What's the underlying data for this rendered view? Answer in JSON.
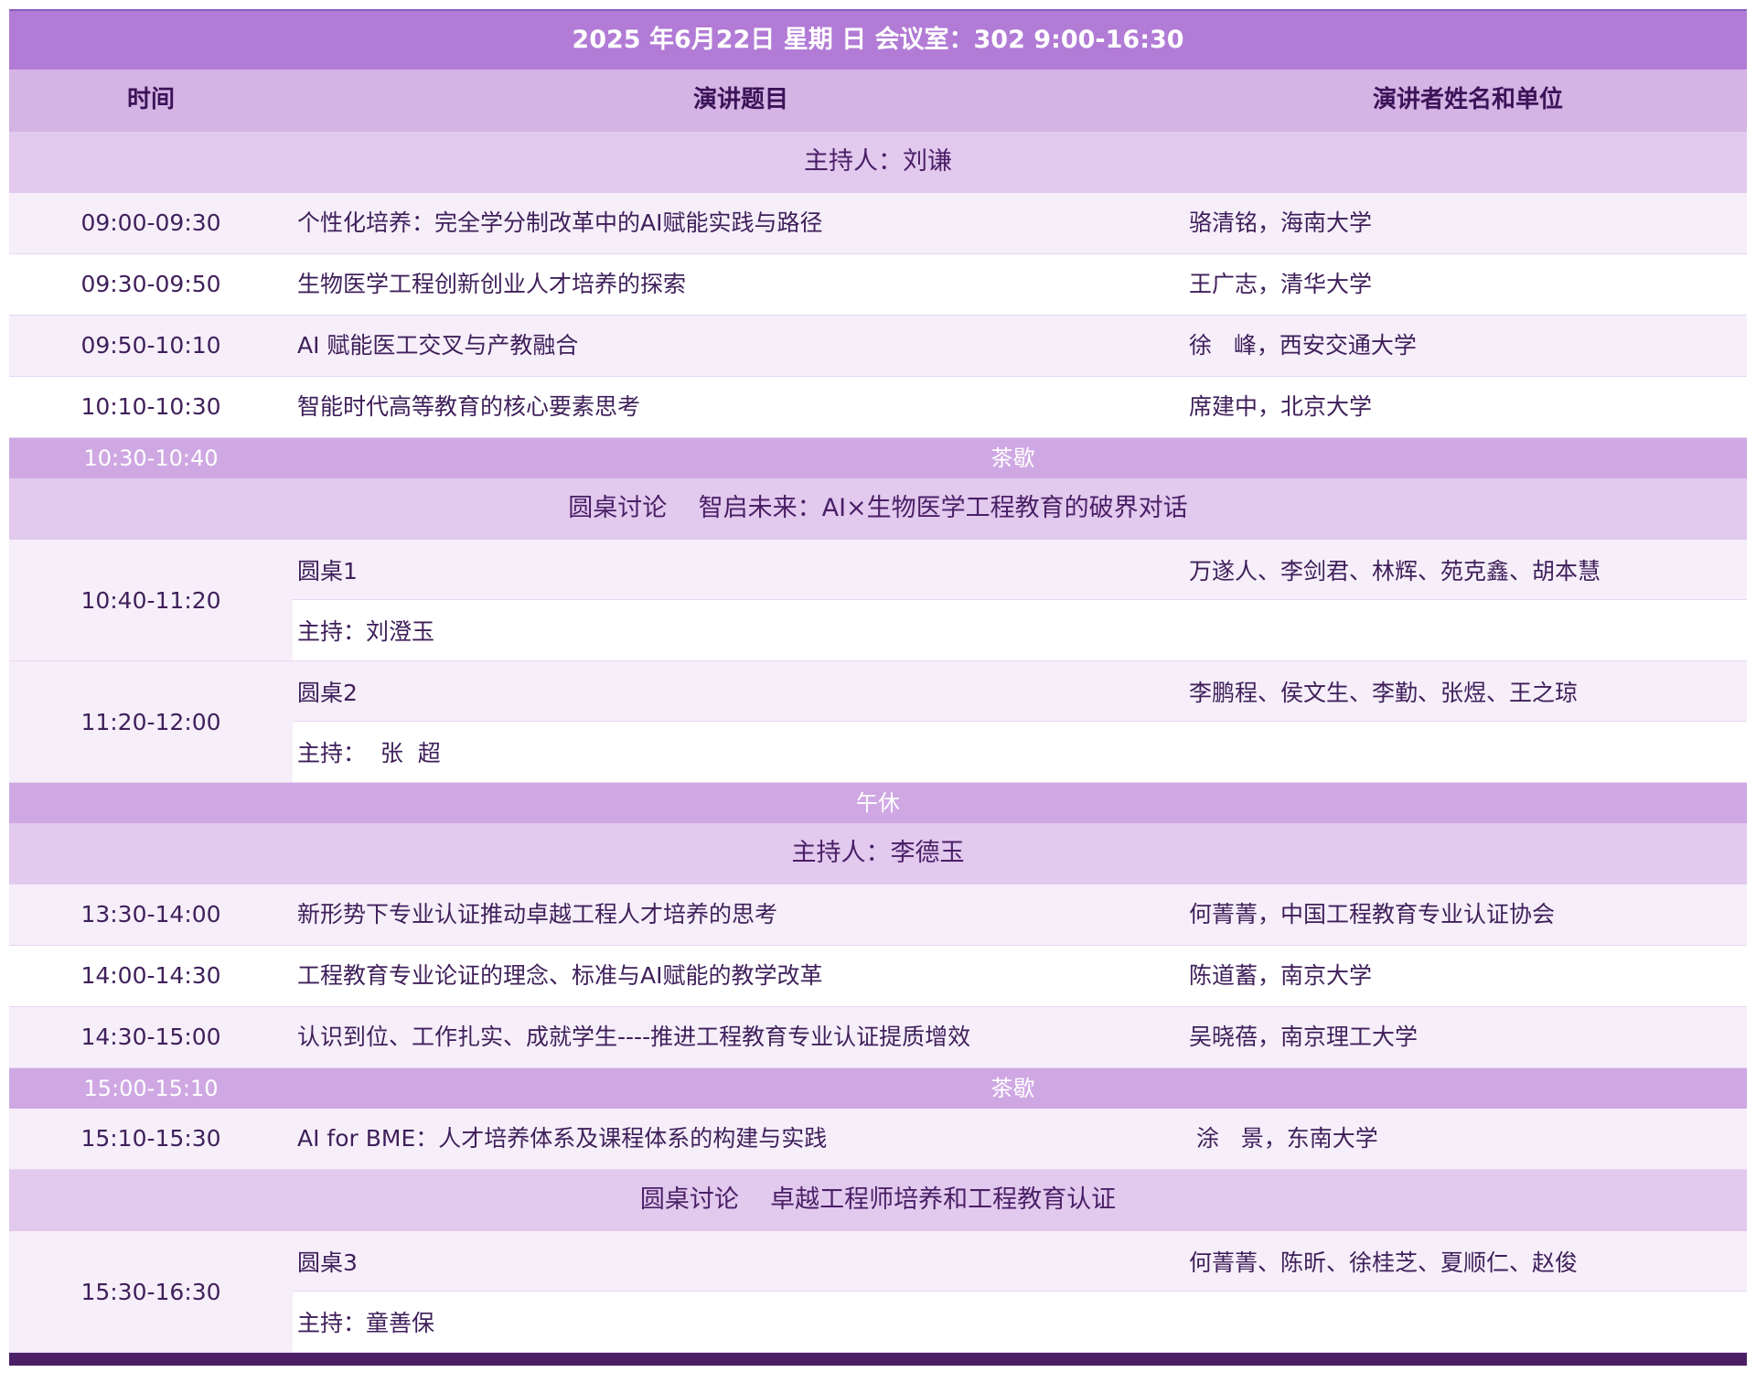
{
  "header": {
    "title": "2025 年6月22日  星期 日  会议室：302    9:00-16:30"
  },
  "columns": {
    "time": "时间",
    "title": "演讲题目",
    "speaker": "演讲者姓名和单位"
  },
  "sections": {
    "host1": "主持人：刘谦",
    "panel1": "圆桌讨论    智启未来：AI×生物医学工程教育的破界对话",
    "lunch": "午休",
    "host2": "主持人：李德玉",
    "panel2": "圆桌讨论    卓越工程师培养和工程教育认证"
  },
  "talks1": [
    {
      "time": "09:00-09:30",
      "title": "个性化培养：完全学分制改革中的AI赋能实践与路径",
      "speaker": "骆清铭，海南大学"
    },
    {
      "time": "09:30-09:50",
      "title": "生物医学工程创新创业人才培养的探索",
      "speaker": "王广志，清华大学"
    },
    {
      "time": "09:50-10:10",
      "title": "AI 赋能医工交叉与产教融合",
      "speaker": "徐   峰，西安交通大学"
    },
    {
      "time": "10:10-10:30",
      "title": "智能时代高等教育的核心要素思考",
      "speaker": "席建中，北京大学"
    }
  ],
  "break1": {
    "time": "10:30-10:40",
    "label": "茶歇"
  },
  "roundtables1": [
    {
      "time": "10:40-11:20",
      "name": "圆桌1",
      "members": "万遂人、李剑君、林辉、苑克鑫、胡本慧",
      "host": "主持：刘澄玉"
    },
    {
      "time": "11:20-12:00",
      "name": "圆桌2",
      "members": "李鹏程、侯文生、李勤、张煜、王之琼",
      "host": "主持：  张  超"
    }
  ],
  "talks2": [
    {
      "time": "13:30-14:00",
      "title": "新形势下专业认证推动卓越工程人才培养的思考",
      "speaker": "何菁菁，中国工程教育专业认证协会"
    },
    {
      "time": "14:00-14:30",
      "title": "工程教育专业论证的理念、标准与AI赋能的教学改革",
      "speaker": "陈道蓄，南京大学"
    },
    {
      "time": "14:30-15:00",
      "title": "认识到位、工作扎实、成就学生----推进工程教育专业认证提质增效",
      "speaker": "吴晓蓓，南京理工大学"
    }
  ],
  "break2": {
    "time": "15:00-15:10",
    "label": "茶歇"
  },
  "talk3": {
    "time": "15:10-15:30",
    "title": "AI for BME：人才培养体系及课程体系的构建与实践",
    "speaker": " 涂   景，东南大学"
  },
  "roundtable3": {
    "time": "15:30-16:30",
    "name": "圆桌3",
    "members": "何菁菁、陈昕、徐桂芝、夏顺仁、赵俊",
    "host": "主持：童善保"
  },
  "colors": {
    "title_bg": "#b17bd6",
    "header_bg": "#d5b3e5",
    "section_bg": "#e2c9ee",
    "break_bg": "#cfa8e3",
    "bottom_bar": "#4b1f66"
  }
}
